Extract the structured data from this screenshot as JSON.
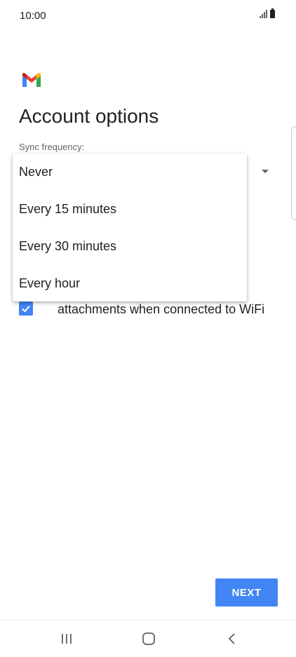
{
  "status_bar": {
    "time": "10:00",
    "signal_icon": "signal-icon",
    "battery_icon": "battery-icon"
  },
  "header": {
    "logo_icon": "gmail-logo-icon",
    "title": "Account options"
  },
  "sync": {
    "label": "Sync frequency:",
    "options": [
      "Never",
      "Every 15 minutes",
      "Every 30 minutes",
      "Every hour"
    ]
  },
  "download_attachments": {
    "checked": true,
    "label": "attachments when connected to WiFi"
  },
  "actions": {
    "next_label": "NEXT"
  },
  "colors": {
    "accent": "#4285f4",
    "text": "#202124"
  }
}
